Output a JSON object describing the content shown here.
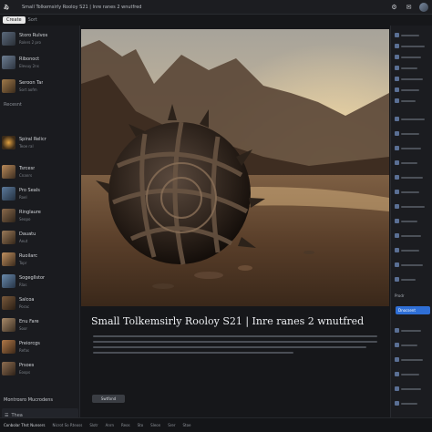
{
  "app": {
    "logo": "ゐ",
    "title": "Small Tolkemsirly Rooloy S21 | Inre ranes 2 wnutfred"
  },
  "toolbar": {
    "icons": [
      "settings-icon",
      "notifications-icon",
      "close-icon"
    ]
  },
  "subbar": {
    "button_label": "Create",
    "meta": "Sort"
  },
  "sidebar": {
    "items": [
      {
        "title": "Storo Rulvos",
        "meta": "Rolers 2 pro"
      },
      {
        "title": "Ribonoct",
        "meta": "Elevuy 2ns"
      },
      {
        "title": "Seroon Tar",
        "meta": "Sort aofm"
      },
      {
        "title": "Spiral Relicr",
        "meta": "Teoe ral"
      },
      {
        "title": "Tsrcesr",
        "meta": "Cnanrs"
      },
      {
        "title": "Pro Seals",
        "meta": "Roel"
      },
      {
        "title": "Ringlaure",
        "meta": "Seopo"
      },
      {
        "title": "Dauatu",
        "meta": "Aeut"
      },
      {
        "title": "Ruoilarc",
        "meta": "Topr"
      },
      {
        "title": "Sogegllstor",
        "meta": "Rlas"
      },
      {
        "title": "Salcoa",
        "meta": "Porac"
      },
      {
        "title": "Enu Fare",
        "meta": "Soor"
      },
      {
        "title": "Preiorcgs",
        "meta": "Refas"
      },
      {
        "title": "Prsoes",
        "meta": "Eoops"
      }
    ],
    "section_label": "Recesnt",
    "footer_label": "Montrosro Mucrodens",
    "footer2_label": "Thea"
  },
  "main": {
    "caption": "Small Tolkemsirly Rooloy S21 | Inre ranes 2 wnutfred",
    "tag_label": "Swtfond"
  },
  "rightpanel": {
    "section_label": "Prodr",
    "button_label": "Dnocsent"
  },
  "bottombar": {
    "items": [
      "Conbolar Thst Nunsers",
      "Nicrot So Rteoss",
      "Slotr",
      "Anrn",
      "Reos",
      "Sto",
      "Sleon",
      "Srer",
      "Stoe"
    ]
  },
  "colors": {
    "accent": "#2f6fd6",
    "background": "#16171a"
  }
}
